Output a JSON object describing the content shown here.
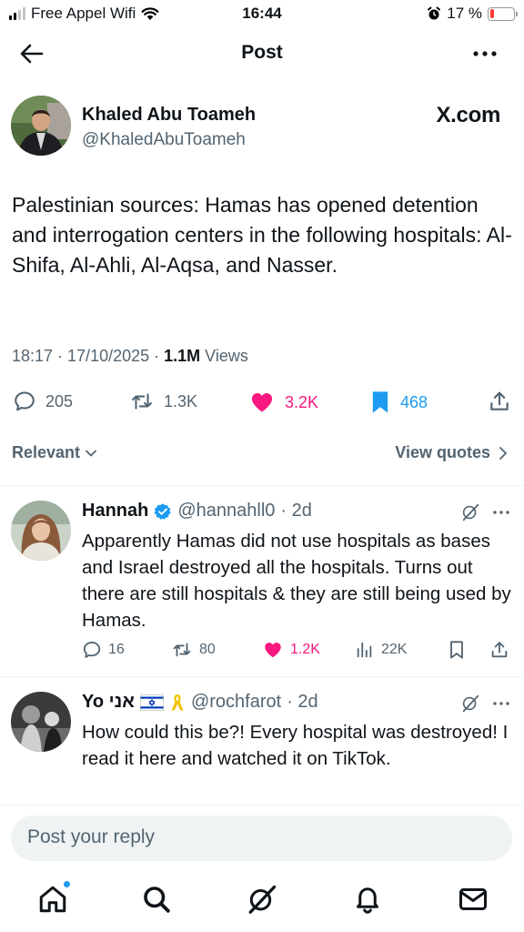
{
  "status_bar": {
    "carrier": "Free Appel Wifi",
    "time": "16:44",
    "battery": "17 %",
    "battery_level": 0.17
  },
  "header": {
    "title": "Post"
  },
  "tweet": {
    "author_name": "Khaled Abu Toameh",
    "author_handle": "@KhaledAbuToameh",
    "source": "X.com",
    "text": "Palestinian sources: Hamas has opened detention and interrogation centers in the following hospitals: Al-Shifa, Al-Ahli, Al-Aqsa, and Nasser.",
    "timestamp": "18:17 · 17/10/2025 · ",
    "views_count": "1.1M",
    "views_label": " Views",
    "stats": {
      "replies": "205",
      "reposts": "1.3K",
      "likes": "3.2K",
      "bookmarks": "468"
    }
  },
  "filter": {
    "sort_label": "Relevant",
    "quotes_label": "View quotes"
  },
  "replies": [
    {
      "name": "Hannah",
      "handle": "@hannahll0",
      "time": "· 2d",
      "text": "Apparently Hamas did not use hospitals as bases and Israel destroyed all the hospitals. Turns out there are still hospitals & they are still being used by Hamas.",
      "stats": {
        "replies": "16",
        "reposts": "80",
        "likes": "1.2K",
        "views": "22K"
      }
    },
    {
      "name": "Yo אני",
      "handle": "@rochfarot",
      "time": "· 2d",
      "text": "How could this be?! Every hospital was destroyed! I read it here and watched it on TikTok."
    }
  ],
  "reply_box": {
    "placeholder": "Post your reply"
  },
  "icons": {
    "back": "arrow-left-icon",
    "more": "more-dots-icon",
    "reply": "comment-icon",
    "repost": "repost-icon",
    "like": "heart-icon",
    "bookmark": "bookmark-icon",
    "share": "share-icon",
    "grok": "grok-icon",
    "home": "home-icon",
    "search": "search-icon",
    "notifications": "bell-icon",
    "messages": "mail-icon"
  },
  "colors": {
    "like": "#f91880",
    "accent": "#1d9bf0",
    "verified": "#1d9bf0",
    "muted": "#536471"
  }
}
